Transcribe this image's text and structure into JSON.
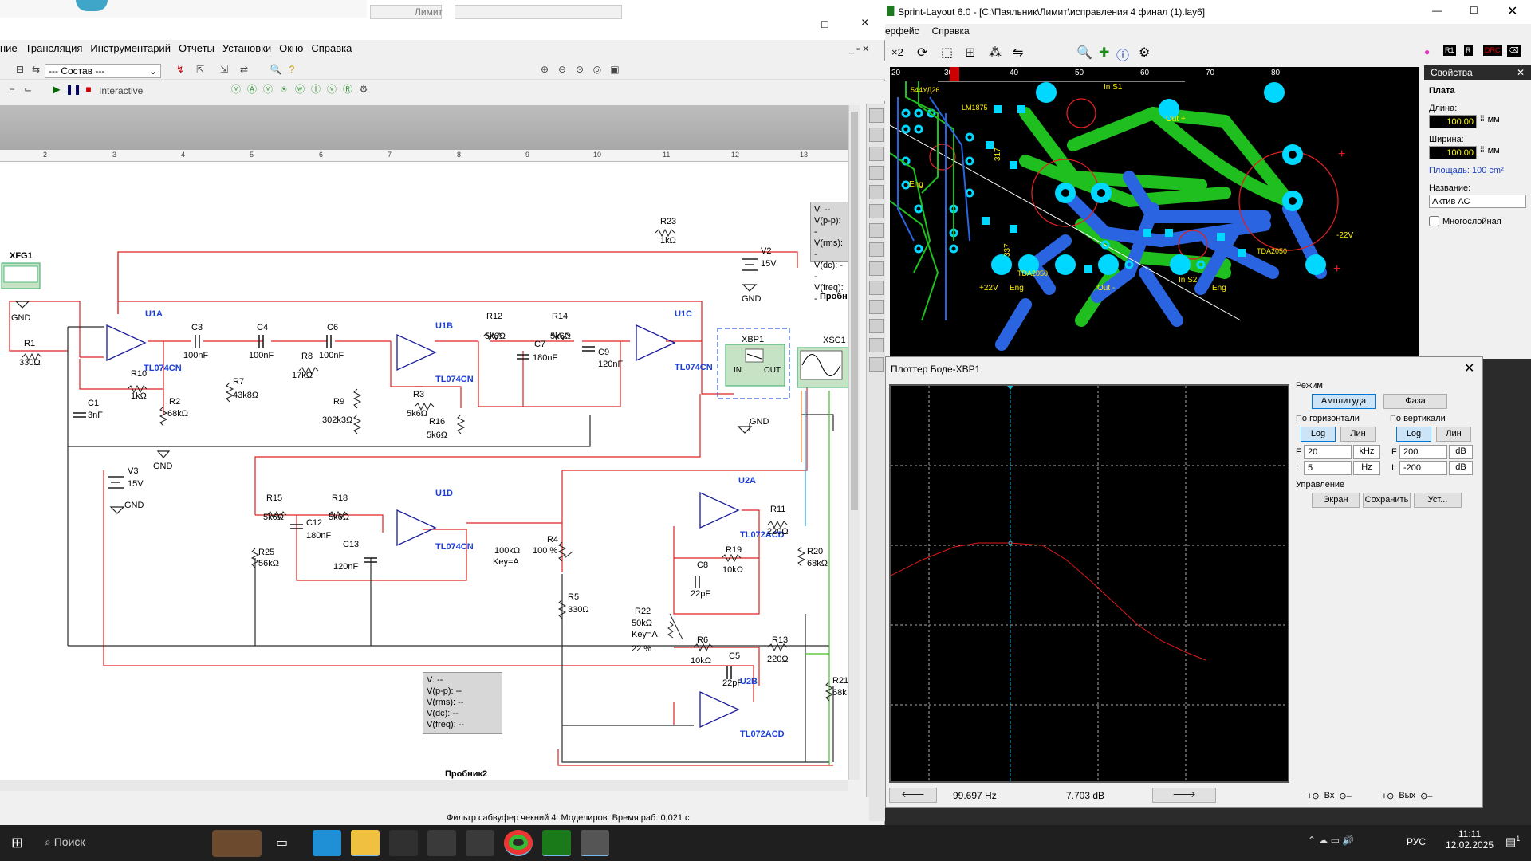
{
  "multisim": {
    "title_partial": "",
    "menu": [
      "ние",
      "Трансляция",
      "Инструментарий",
      "Отчеты",
      "Установки",
      "Окно",
      "Справка"
    ],
    "combo_value": "--- Состав ---",
    "interactive_label": "Interactive",
    "ruler_numbers": [
      "2",
      "3",
      "4",
      "5",
      "6",
      "7",
      "8",
      "9",
      "10",
      "11",
      "12",
      "13"
    ],
    "status_text": "Фильтр сабвуфер чекний 4: Моделиров: Время раб: 0,021 с",
    "win_buttons": [
      "□",
      "×"
    ]
  },
  "schematic": {
    "components": {
      "XFG1": "XFG1",
      "GND": "GND",
      "R1": "R1",
      "R1v": "330Ω",
      "C1": "C1",
      "C1v": "3nF",
      "U1A": "U1A",
      "TL074CN": "TL074CN",
      "C3": "C3",
      "C3v": "100nF",
      "C4": "C4",
      "C4v": "100nF",
      "C6": "C6",
      "C6v": "100nF",
      "R8": "R8",
      "R8v": "17kΩ",
      "R7": "R7",
      "R7v": "43k8Ω",
      "R9": "R9",
      "R9v": "302k3Ω",
      "R10": "R10",
      "R10v": "1kΩ",
      "R2": "R2",
      "R2v": "68kΩ",
      "U1B": "U1B",
      "R3": "R3",
      "R3v": "5k6Ω",
      "R16": "R16",
      "R16v": "5k6Ω",
      "R12": "R12",
      "R12v": "5k6Ω",
      "R14": "R14",
      "R14v": "5k6Ω",
      "C7": "C7",
      "C7v": "180nF",
      "C9": "C9",
      "C9v": "120nF",
      "U1C": "U1C",
      "R23": "R23",
      "R23v": "1kΩ",
      "V2": "V2",
      "V2v": "15V",
      "XBP1": "XBP1",
      "IN": "IN",
      "OUT": "OUT",
      "XSC1": "XSC1",
      "V3": "V3",
      "V3v": "15V",
      "R15": "R15",
      "R15v": "5k6Ω",
      "R18": "R18",
      "R18v": "5k6Ω",
      "C12": "C12",
      "C12v": "180nF",
      "C13": "C13",
      "C13v": "120nF",
      "U1D": "U1D",
      "R25": "R25",
      "R25v": "56kΩ",
      "R4": "R4",
      "R4v": "100kΩ",
      "R4k": "Key=A",
      "R4p": "100 %",
      "R5": "R5",
      "R5v": "330Ω",
      "U2A": "U2A",
      "TL072ACD": "TL072ACD",
      "R11": "R11",
      "R11v": "220Ω",
      "R19": "R19",
      "R19v": "10kΩ",
      "C8": "C8",
      "C8v": "22pF",
      "R20": "R20",
      "R20v": "68kΩ",
      "R22": "R22",
      "R22v": "50kΩ",
      "R22k": "Key=A",
      "R22p": "22 %",
      "R6": "R6",
      "R6v": "10kΩ",
      "C5": "C5",
      "C5v": "22pF",
      "R13": "R13",
      "R13v": "220Ω",
      "U2B": "U2B",
      "R21": "R21",
      "R21v": "68k",
      "probe1": "Пробн",
      "probe2": "Пробник2"
    },
    "probe_lines": [
      "V: --",
      "V(p-p): --",
      "V(rms): --",
      "V(dc): --",
      "V(freq): --"
    ],
    "probe_lines_right": [
      "V: --",
      "V(p-p): -",
      "V(rms): -",
      "V(dc): --",
      "V(freq): -"
    ]
  },
  "sprint": {
    "title": "Sprint-Layout 6.0 - [C:\\Паяльник\\Лимит\\исправления 4 финал (1).lay6]",
    "menu": [
      "ерфейс",
      "Справка"
    ],
    "ruler": [
      "20",
      "30",
      "40",
      "50",
      "60",
      "70",
      "80"
    ],
    "pcb_labels": [
      "544УД26",
      "LM1875",
      "In S1",
      "Out +",
      "317",
      "337",
      "In S2",
      "-22V",
      "+22V",
      "Eng",
      "Out -",
      "Eng",
      "Eng",
      "TDA2050",
      "TDA2050"
    ],
    "props": {
      "header": "Свойства",
      "section": "Плата",
      "length_label": "Длина:",
      "length_value": "100.00",
      "width_label": "Ширина:",
      "width_value": "100.00",
      "unit": "мм",
      "area_label": "Площадь:",
      "area_value": "100 cm²",
      "name_label": "Название:",
      "name_value": "Актив АС",
      "multilayer_label": "Многослойная"
    }
  },
  "bode": {
    "title": "Плоттер Боде-XBP1",
    "mode_label": "Режим",
    "amp_btn": "Амплитуда",
    "phase_btn": "Фаза",
    "horiz_label": "По горизонтали",
    "vert_label": "По вертикали",
    "log_btn": "Log",
    "lin_btn": "Лин",
    "F_label": "F",
    "I_label": "I",
    "h_F": "20",
    "h_F_unit": "kHz",
    "h_I": "5",
    "h_I_unit": "Hz",
    "v_F": "200",
    "v_F_unit": "dB",
    "v_I": "-200",
    "v_I_unit": "dB",
    "control_label": "Управление",
    "screen_btn": "Экран",
    "save_btn": "Сохранить",
    "set_btn": "Уст...",
    "readout_freq": "99.697 Hz",
    "readout_gain": "7.703 dB",
    "in_label": "Вх",
    "out_label": "Вых"
  },
  "taskbar": {
    "search": "Поиск",
    "lang": "РУС",
    "time": "11:11",
    "date": "12.02.2025",
    "notif": "1"
  }
}
